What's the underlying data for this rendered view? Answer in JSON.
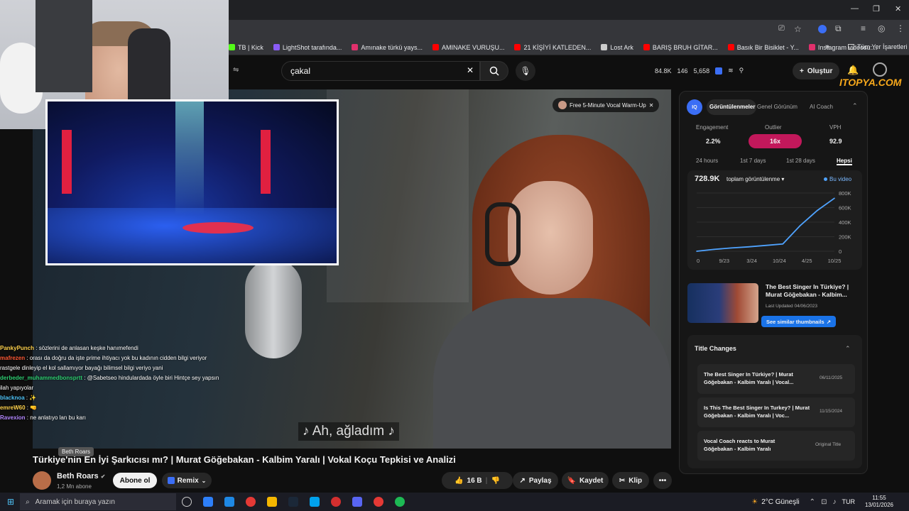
{
  "browser": {
    "bookmarks": [
      {
        "label": "TB | Kick",
        "color": "#53fc18"
      },
      {
        "label": "LightShot tarafında...",
        "color": "#8a5cf6"
      },
      {
        "label": "Amınake türkü yays...",
        "color": "#e1306c"
      },
      {
        "label": "AMINAKE VURUŞU...",
        "color": "#ff0000"
      },
      {
        "label": "21 KİŞİYİ KATLEDEN...",
        "color": "#ff0000"
      },
      {
        "label": "Lost Ark",
        "color": "#cccccc"
      },
      {
        "label": "BARIŞ BRUH GİTAR...",
        "color": "#ff0000"
      },
      {
        "label": "Basık Bir Bisiklet - Y...",
        "color": "#ff0000"
      },
      {
        "label": "Instagram videosu:...",
        "color": "#e1306c"
      }
    ],
    "bookmarks_more": "»",
    "all_bookmarks": "Tüm Yer İşaretleri",
    "window_min": "—",
    "window_max": "❐",
    "window_close": "✕"
  },
  "youtube": {
    "search_value": "çakal",
    "search_clear": "✕",
    "search_icon": "search-icon",
    "stats": {
      "views": "84.8K",
      "likes": "146",
      "count": "5,658"
    },
    "create_label": "Oluştur",
    "watermark": "ITOPYA.COM"
  },
  "video": {
    "warmup_label": "Free 5-Minute Vocal Warm-Up",
    "subtitle": "♪ Ah, ağladım ♪",
    "title": "Türkiye'nin En İyi Şarkıcısı mı? | Murat Göğebakan - Kalbim Yaralı | Vokal Koçu Tepkisi ve Analizi",
    "tooltip": "Beth Roars",
    "channel_name": "Beth Roars",
    "subscribers": "1,2 Mn abone",
    "subscribe_label": "Abone ol",
    "remix_label": "Remix",
    "like_count": "16 B",
    "share_label": "Paylaş",
    "save_label": "Kaydet",
    "clip_label": "Klip",
    "more_label": "•••"
  },
  "chat": [
    {
      "user": "PankyPunch",
      "color": "#ffd24d",
      "text": "sözlerini de anlasan keşke hanımefendi"
    },
    {
      "user": "mafrezen",
      "color": "#ff5a36",
      "text": "orası da doğru da işte prime ihtiyacı yok bu kadının cidden bilgi veriyor rastgele dinleyip el kol sallamıyor bayağı bilimsel bilgi veriyo yani"
    },
    {
      "user": "derbeder_muhammedbonsprtt",
      "color": "#2ecc71",
      "text": "@Sabetseo hindulardada öyle biri Hintçe sey yapsın ilah yapıyolar"
    },
    {
      "user": "blacknoa",
      "color": "#4fc3f7",
      "text": "✨"
    },
    {
      "user": "emreW60",
      "color": "#ffd24d",
      "text": "🤜"
    },
    {
      "user": "Ravexion",
      "color": "#b388ff",
      "text": "ne anlatıyo lan bu karı"
    }
  ],
  "panel": {
    "tabs": [
      "Görüntülenmeler",
      "Genel Görünüm",
      "AI Coach"
    ],
    "metrics": [
      {
        "label": "Engagement",
        "value": "2.2%"
      },
      {
        "label": "Outlier",
        "value": "16x"
      },
      {
        "label": "VPH",
        "value": "92.9"
      }
    ],
    "ranges": [
      "24 hours",
      "1st 7 days",
      "1st 28 days",
      "Hepsi"
    ],
    "total_views": "728.9K",
    "views_dropdown": "toplam görüntülenme",
    "legend": "Bu video",
    "similar": {
      "title": "The Best Singer In Türkiye? | Murat Göğebakan - Kalbim...",
      "updated": "Last Updated 04/06/2023",
      "button": "See similar thumbnails"
    },
    "title_changes_header": "Title Changes",
    "title_changes": [
      {
        "title": "The Best Singer In Türkiye? | Murat Göğebakan - Kalbim Yaralı | Vocal...",
        "date": "06/11/2025"
      },
      {
        "title": "Is This The Best Singer In Turkey? | Murat Göğebakan - Kalbim Yaralı | Voc...",
        "date": "11/15/2024"
      },
      {
        "title": "Vocal Coach reacts to Murat Göğebakan - Kalbim Yaralı",
        "date": "Original Title"
      }
    ]
  },
  "chart_data": {
    "type": "line",
    "x": [
      "0",
      "9/23",
      "3/24",
      "10/24",
      "4/25",
      "10/25"
    ],
    "series": [
      {
        "values": [
          0,
          25,
          45,
          60,
          80,
          100,
          350,
          560,
          729
        ]
      }
    ],
    "ylim": [
      0,
      800
    ],
    "yticks": [
      "800K",
      "600K",
      "400K",
      "200K",
      "0"
    ]
  },
  "taskbar": {
    "search_placeholder": "Aramak için buraya yazın",
    "weather": "2°C  Güneşli",
    "lang": "TUR",
    "time": "11:55",
    "date": "13/01/2026"
  }
}
